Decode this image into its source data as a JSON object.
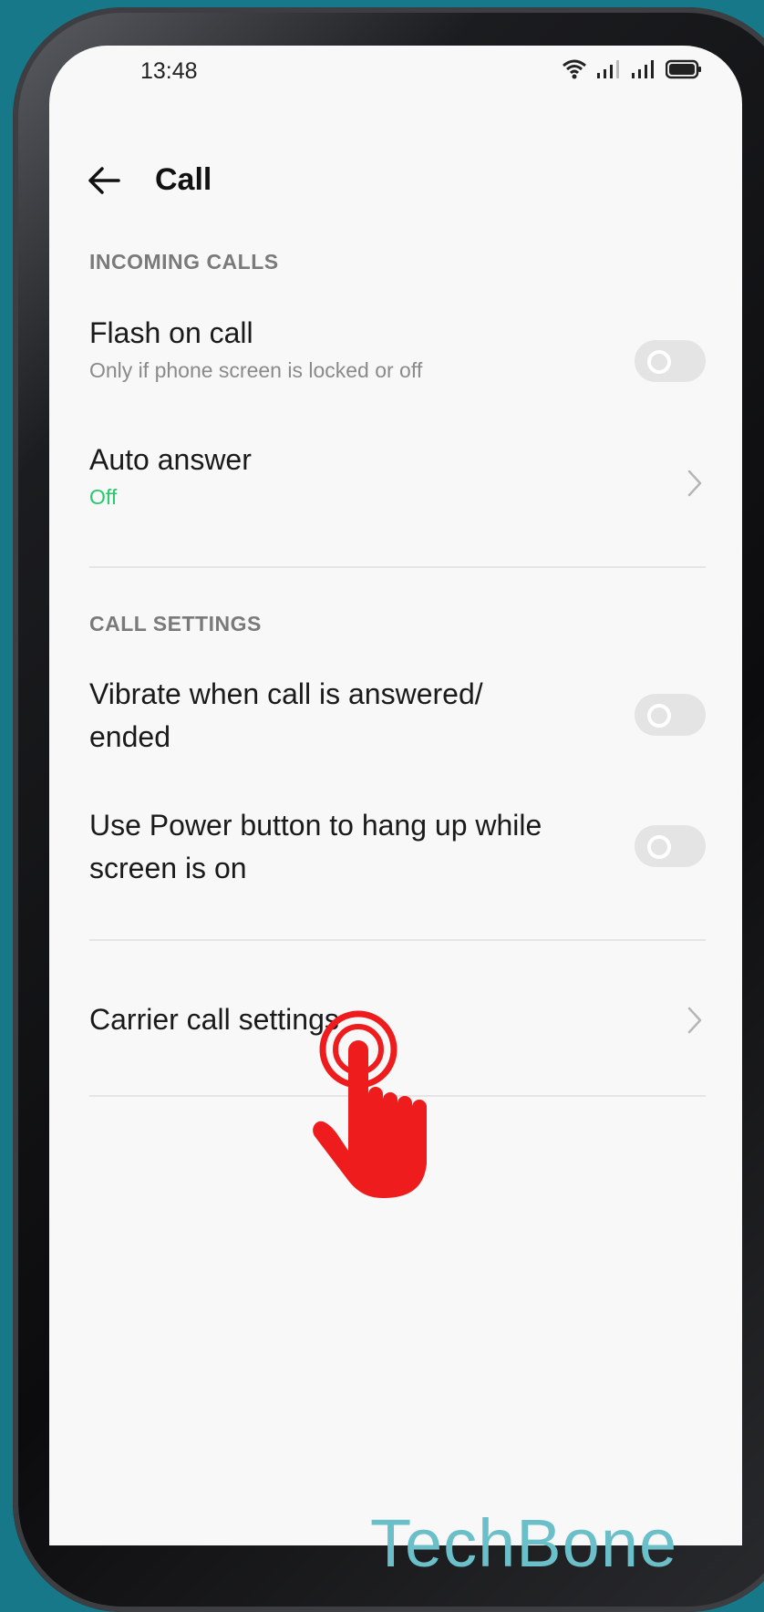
{
  "status_bar": {
    "time": "13:48",
    "icons": [
      "wifi-icon",
      "signal-icon",
      "signal-icon",
      "battery-icon"
    ]
  },
  "header": {
    "back_icon": "arrow-left-icon",
    "title": "Call"
  },
  "sections": {
    "incoming_calls": {
      "title": "INCOMING CALLS",
      "flash_on_call": {
        "label": "Flash on call",
        "subtitle": "Only if phone screen is locked or off",
        "enabled": false
      },
      "auto_answer": {
        "label": "Auto answer",
        "value": "Off"
      }
    },
    "call_settings": {
      "title": "CALL SETTINGS",
      "vibrate": {
        "label_line1": "Vibrate when call is answered/",
        "label_line2": "ended",
        "enabled": false
      },
      "power_button": {
        "label_line1": "Use Power button to hang up while",
        "label_line2": "screen is on",
        "enabled": false
      }
    },
    "carrier": {
      "label": "Carrier call settings"
    }
  },
  "overlay": {
    "tap_indicator_icon": "tap-hand-icon"
  },
  "watermark": "TechBone",
  "colors": {
    "background": "#17788a",
    "screen": "#f8f8f8",
    "accent_green": "#26c96b",
    "tap_red": "#ee1c1c",
    "watermark": "#6bbfc8"
  }
}
